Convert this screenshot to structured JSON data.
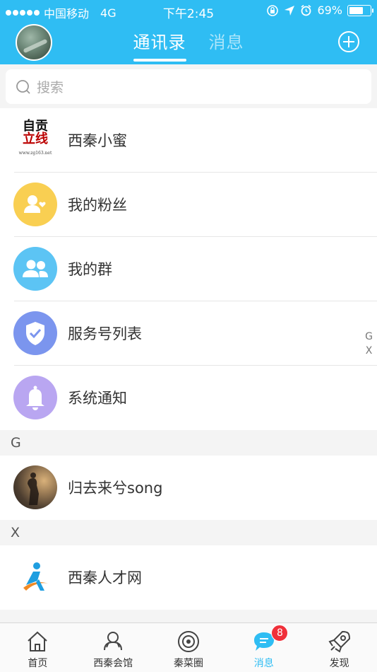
{
  "status_bar": {
    "carrier": "中国移动",
    "network": "4G",
    "time": "下午2:45",
    "battery": "69%",
    "battery_level": 0.69
  },
  "header": {
    "tabs": [
      {
        "label": "通讯录",
        "active": true
      },
      {
        "label": "消息",
        "active": false
      }
    ]
  },
  "search": {
    "placeholder": "搜索"
  },
  "list": {
    "top_items": [
      {
        "label": "西秦小蜜",
        "icon": "zgfx-logo-icon"
      },
      {
        "label": "我的粉丝",
        "icon": "fans-icon",
        "color": "#f9cf52"
      },
      {
        "label": "我的群",
        "icon": "group-icon",
        "color": "#5cc4f4"
      },
      {
        "label": "服务号列表",
        "icon": "shield-check-icon",
        "color": "#7b95ee"
      },
      {
        "label": "系统通知",
        "icon": "bell-icon",
        "color": "#b9a6f1"
      }
    ],
    "sections": [
      {
        "letter": "G",
        "items": [
          {
            "label": "归去来兮song"
          }
        ]
      },
      {
        "letter": "X",
        "items": [
          {
            "label": "西秦人才网"
          }
        ]
      }
    ],
    "logo_text": {
      "line1": "自贡",
      "line2": "立线",
      "url": "www.zg163.net"
    }
  },
  "index_letters": [
    "G",
    "X"
  ],
  "bottom_nav": {
    "items": [
      {
        "label": "首页",
        "icon": "home-icon"
      },
      {
        "label": "西秦会馆",
        "icon": "hall-icon"
      },
      {
        "label": "秦菜圈",
        "icon": "circle-icon"
      },
      {
        "label": "消息",
        "icon": "message-icon",
        "active": true,
        "badge": "8"
      },
      {
        "label": "发现",
        "icon": "rocket-icon"
      }
    ]
  },
  "colors": {
    "accent": "#2fbdf3",
    "badge": "#f0303a"
  }
}
